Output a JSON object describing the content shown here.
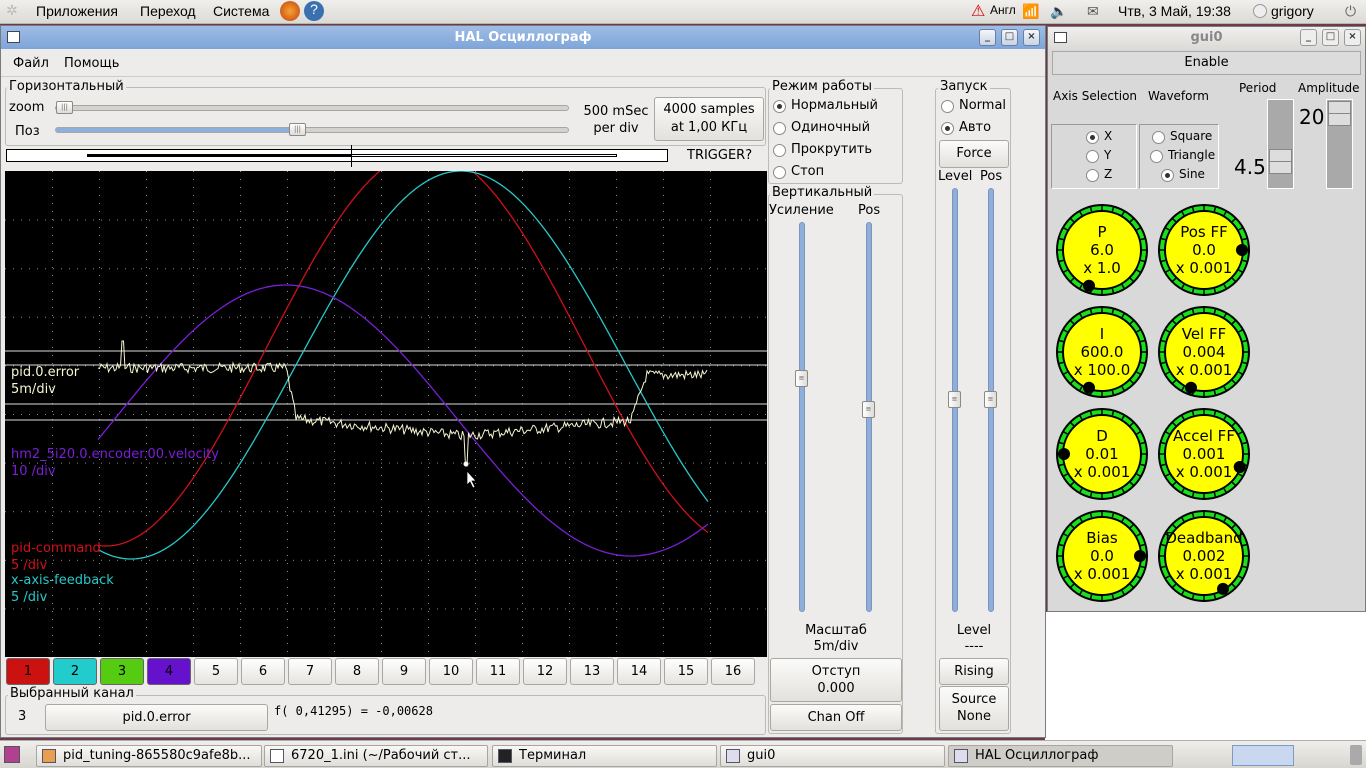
{
  "top_panel": {
    "menus": [
      "Приложения",
      "Переход",
      "Система"
    ],
    "keyboard": "Англ",
    "datetime": "Чтв, 3 Май, 19:38",
    "user": "grigory"
  },
  "scope": {
    "title": "HAL Осциллограф",
    "menu": [
      "Файл",
      "Помощь"
    ],
    "horizontal": {
      "label": "Горизонтальный",
      "zoom_label": "zoom",
      "pos_label": "Поз",
      "rate": "500 mSec",
      "rate2": "per div",
      "samples": "4000 samples",
      "samples2": "at 1,00 КГц",
      "trigger": "TRIGGER?",
      "zoom_value": 0.0,
      "pos_value": 0.5
    },
    "mode": {
      "label": "Режим работы",
      "options": [
        "Нормальный",
        "Одиночный",
        "Прокрутить",
        "Стоп"
      ],
      "selected": 0
    },
    "run": {
      "label": "Запуск",
      "options": [
        "Normal",
        "Авто"
      ],
      "selected": 1,
      "force": "Force",
      "level": "Level",
      "pos": "Pos",
      "level_label": "Level",
      "level_value": "----",
      "rising": "Rising",
      "source": "Source",
      "source_value": "None"
    },
    "vertical": {
      "label": "Вертикальный",
      "gain": "Усиление",
      "pos": "Pos",
      "scale_label": "Масштаб",
      "scale_value": "5m/div",
      "offset_label": "Отступ",
      "offset_value": "0.000",
      "chan_off": "Chan Off"
    },
    "traces": [
      {
        "name": "pid.0.error",
        "scale": "5m/div",
        "color": "#f5f5d0"
      },
      {
        "name": "hm2_5i20.0.encoder.00.velocity",
        "scale": "10 /div",
        "color": "#7a1fd6"
      },
      {
        "name": "pid-command",
        "scale": "5 /div",
        "color": "#d0101a"
      },
      {
        "name": "x-axis-feedback",
        "scale": "5 /div",
        "color": "#28c8c8"
      }
    ],
    "channels": [
      {
        "n": "1",
        "color": "#cc1111"
      },
      {
        "n": "2",
        "color": "#22cccc"
      },
      {
        "n": "3",
        "color": "#55cc11"
      },
      {
        "n": "4",
        "color": "#6611cc"
      },
      {
        "n": "5"
      },
      {
        "n": "6"
      },
      {
        "n": "7"
      },
      {
        "n": "8"
      },
      {
        "n": "9"
      },
      {
        "n": "10"
      },
      {
        "n": "11"
      },
      {
        "n": "12"
      },
      {
        "n": "13"
      },
      {
        "n": "14"
      },
      {
        "n": "15"
      },
      {
        "n": "16"
      }
    ],
    "selected": {
      "label": "Выбранный канал",
      "num": "3",
      "name": "pid.0.error",
      "readout": "f( 0,41295) = -0,00628"
    }
  },
  "gui0": {
    "title": "gui0",
    "enable": "Enable",
    "axis_label": "Axis Selection",
    "waveform_label": "Waveform",
    "period_label": "Period",
    "amplitude_label": "Amplitude",
    "axes": [
      "X",
      "Y",
      "Z"
    ],
    "axis_selected": 0,
    "waveforms": [
      "Square",
      "Triangle",
      "Sine"
    ],
    "waveform_selected": 2,
    "period": "4.5",
    "amplitude": "20",
    "knobs": [
      {
        "name": "P",
        "value": "6.0",
        "scale": "x 1.0"
      },
      {
        "name": "Pos FF",
        "value": "0.0",
        "scale": "x 0.001"
      },
      {
        "name": "I",
        "value": "600.0",
        "scale": "x 100.0"
      },
      {
        "name": "Vel FF",
        "value": "0.004",
        "scale": "x 0.001"
      },
      {
        "name": "D",
        "value": "0.01",
        "scale": "x 0.001"
      },
      {
        "name": "Accel FF",
        "value": "0.001",
        "scale": "x 0.001"
      },
      {
        "name": "Bias",
        "value": "0.0",
        "scale": "x 0.001"
      },
      {
        "name": "Deadband",
        "value": "0.002",
        "scale": "x 0.001"
      }
    ]
  },
  "taskbar": [
    "pid_tuning-865580c9afe8b...",
    "6720_1.ini (~/Рабочий ст...",
    "Терминал",
    "gui0",
    "HAL Осциллограф"
  ]
}
